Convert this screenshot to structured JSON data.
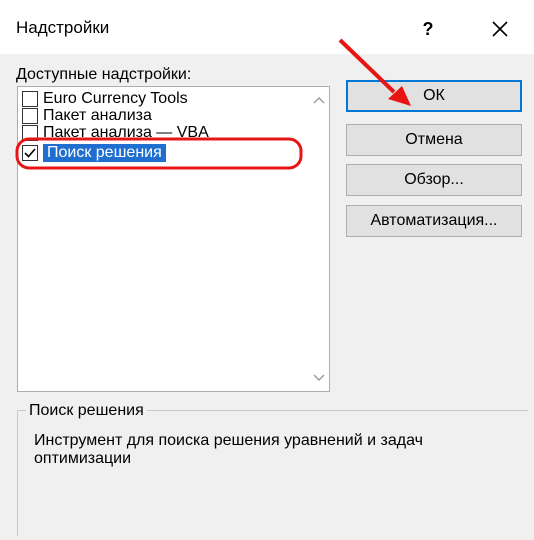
{
  "window": {
    "title": "Надстройки",
    "help_label": "?",
    "close_icon": "close-icon"
  },
  "addins": {
    "label": "Доступные надстройки:",
    "items": [
      {
        "label": "Euro Currency Tools",
        "checked": false,
        "selected": false
      },
      {
        "label": "Пакет анализа",
        "checked": false,
        "selected": false
      },
      {
        "label": "Пакет анализа — VBA",
        "checked": false,
        "selected": false
      },
      {
        "label": "Поиск решения",
        "checked": true,
        "selected": true
      }
    ]
  },
  "buttons": {
    "ok": "ОК",
    "cancel": "Отмена",
    "browse": "Обзор...",
    "automation": "Автоматизация..."
  },
  "details": {
    "group_title": "Поиск решения",
    "description": "Инструмент для поиска решения уравнений и задач оптимизации"
  },
  "colors": {
    "selection": "#1f6fd1",
    "annotation": "#e81515",
    "default_button_border": "#0078d7"
  }
}
